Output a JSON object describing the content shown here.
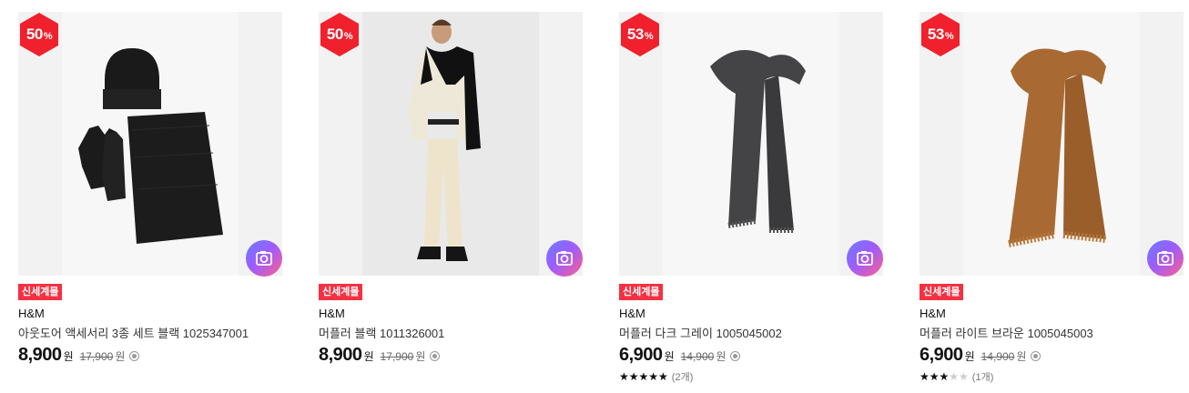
{
  "products": [
    {
      "discount_number": "50",
      "discount_unit": "%",
      "tag": "신세계몰",
      "brand": "H&M",
      "name": "아웃도어 액세서리 3종 세트 블랙 1025347001",
      "price": "8,900",
      "price_unit": "원",
      "original_price": "17,900",
      "original_unit": "원",
      "image": "beanie-gloves-scarf-set-black"
    },
    {
      "discount_number": "50",
      "discount_unit": "%",
      "tag": "신세계몰",
      "brand": "H&M",
      "name": "머플러 블랙 1011326001",
      "price": "8,900",
      "price_unit": "원",
      "original_price": "17,900",
      "original_unit": "원",
      "image": "model-wearing-black-scarf"
    },
    {
      "discount_number": "53",
      "discount_unit": "%",
      "tag": "신세계몰",
      "brand": "H&M",
      "name": "머플러 다크 그레이 1005045002",
      "price": "6,900",
      "price_unit": "원",
      "original_price": "14,900",
      "original_unit": "원",
      "rating": 5,
      "rating_max": 5,
      "review_count": "(2개)",
      "image": "dark-grey-scarf"
    },
    {
      "discount_number": "53",
      "discount_unit": "%",
      "tag": "신세계몰",
      "brand": "H&M",
      "name": "머플러 라이트 브라운 1005045003",
      "price": "6,900",
      "price_unit": "원",
      "original_price": "14,900",
      "original_unit": "원",
      "rating": 3,
      "rating_max": 5,
      "review_count": "(1개)",
      "image": "light-brown-scarf"
    }
  ],
  "colors": {
    "discount_badge": "#f0202c",
    "tag_background": "#f43142",
    "camera_gradient": [
      "#6a7cff",
      "#9b5cff",
      "#ff5f8f"
    ]
  },
  "icons": {
    "discount": "hexagon-badge",
    "camera": "camera-search-icon",
    "info": "info-circle-icon",
    "star": "star-icon"
  }
}
